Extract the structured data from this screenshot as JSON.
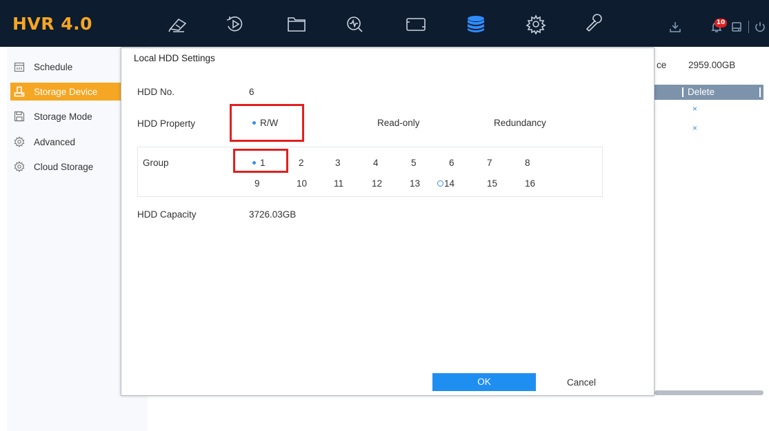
{
  "header": {
    "brand": "HVR 4.0",
    "nav_icons": [
      "camera-icon",
      "playback-icon",
      "files-icon",
      "smart-analysis-icon",
      "display-icon",
      "storage-icon",
      "settings-gear-icon",
      "maintenance-wrench-icon"
    ],
    "active_nav": "storage-icon",
    "status_icons": [
      "download-icon",
      "alarm-bell-icon",
      "hdd-status-icon",
      "power-icon"
    ],
    "alarm_count": "10",
    "colors": {
      "bar": "#0d1c2e",
      "brand": "#f5a623",
      "active_icon": "#2f8cff"
    }
  },
  "sidebar": {
    "items": [
      {
        "label": "Schedule",
        "icon": "calendar-icon"
      },
      {
        "label": "Storage Device",
        "icon": "storage-device-icon",
        "active": true
      },
      {
        "label": "Storage Mode",
        "icon": "save-disk-icon"
      },
      {
        "label": "Advanced",
        "icon": "gear-icon"
      },
      {
        "label": "Cloud Storage",
        "icon": "gear-icon"
      }
    ],
    "active_color": "#f5a623"
  },
  "background": {
    "free_space_label": "ce",
    "free_space_value": "2959.00GB",
    "table_header_delete": "Delete",
    "delete_marks": [
      "×",
      "×"
    ]
  },
  "dialog": {
    "title": "Local HDD Settings",
    "hdd_no_label": "HDD No.",
    "hdd_no_value": "6",
    "property_label": "HDD Property",
    "property_options": [
      "R/W",
      "Read-only",
      "Redundancy"
    ],
    "property_selected": "R/W",
    "group_label": "Group",
    "group_numbers_row1": [
      "1",
      "2",
      "3",
      "4",
      "5",
      "6",
      "7",
      "8"
    ],
    "group_numbers_row2": [
      "9",
      "10",
      "11",
      "12",
      "13",
      "14",
      "15",
      "16"
    ],
    "group_selected": "1",
    "capacity_label": "HDD Capacity",
    "capacity_value": "3726.03GB",
    "ok_label": "OK",
    "cancel_label": "Cancel",
    "colors": {
      "ok_button": "#1f8ef1",
      "highlight": "#e02020",
      "radio_dot": "#3a8ee6"
    }
  }
}
